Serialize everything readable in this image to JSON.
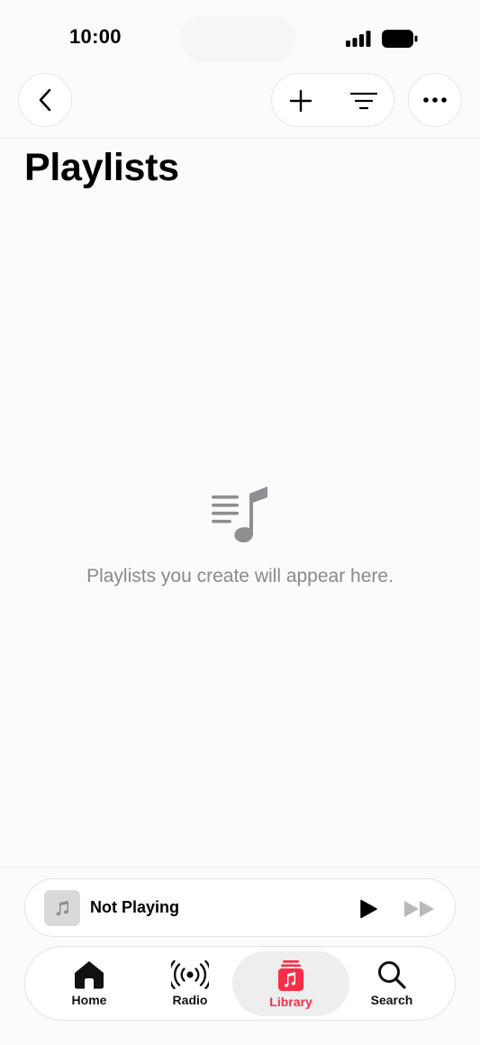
{
  "status_bar": {
    "time": "10:00"
  },
  "header": {
    "title": "Playlists"
  },
  "empty_state": {
    "message": "Playlists you create will appear here."
  },
  "mini_player": {
    "title": "Not Playing"
  },
  "tabs": [
    {
      "label": "Home",
      "icon": "house-icon"
    },
    {
      "label": "Radio",
      "icon": "radio-waves-icon"
    },
    {
      "label": "Library",
      "icon": "library-icon",
      "selected": true
    },
    {
      "label": "Search",
      "icon": "magnifier-icon"
    }
  ],
  "colors": {
    "accent": "#fa2d48",
    "secondary_text": "#8a8a8e",
    "icon_gray": "#8e8e93"
  }
}
